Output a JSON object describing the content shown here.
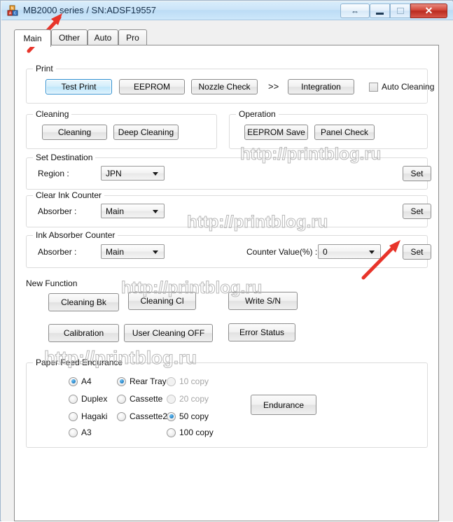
{
  "window": {
    "title": "MB2000 series / SN:ADSF19557",
    "app_icon": "blocks-icon",
    "controls": {
      "resize_label": "⇔",
      "minimize_label": "",
      "maximize_label": "",
      "close_label": "✕"
    }
  },
  "tabs": [
    {
      "label": "Main",
      "active": true
    },
    {
      "label": "Other",
      "active": false
    },
    {
      "label": "Auto",
      "active": false
    },
    {
      "label": "Pro",
      "active": false
    }
  ],
  "print_group": {
    "title": "Print",
    "buttons": [
      {
        "label": "Test Print",
        "focused": true
      },
      {
        "label": "EEPROM",
        "focused": false
      },
      {
        "label": "Nozzle Check",
        "focused": false
      },
      {
        "label": "Integration",
        "focused": false
      }
    ],
    "separator": ">>",
    "checkbox": {
      "label": "Auto Cleaning",
      "checked": false
    }
  },
  "cleaning_group": {
    "title": "Cleaning",
    "buttons": [
      {
        "label": "Cleaning"
      },
      {
        "label": "Deep Cleaning"
      }
    ]
  },
  "operation_group": {
    "title": "Operation",
    "buttons": [
      {
        "label": "EEPROM Save"
      },
      {
        "label": "Panel Check"
      }
    ]
  },
  "set_destination_group": {
    "title": "Set Destination",
    "region_label": "Region :",
    "region_value": "JPN",
    "set_label": "Set"
  },
  "clear_ink_counter_group": {
    "title": "Clear Ink Counter",
    "absorber_label": "Absorber :",
    "absorber_value": "Main",
    "set_label": "Set"
  },
  "ink_absorber_counter_group": {
    "title": "Ink Absorber Counter",
    "absorber_label": "Absorber :",
    "absorber_value": "Main",
    "counter_label": "Counter Value(%) :",
    "counter_value": "0",
    "set_label": "Set"
  },
  "new_function": {
    "title": "New Function",
    "buttons": [
      {
        "label": "Cleaning Bk"
      },
      {
        "label": "Cleaning Cl"
      },
      {
        "label": "Write S/N"
      },
      {
        "label": "Calibration"
      },
      {
        "label": "User Cleaning OFF"
      },
      {
        "label": "Error Status"
      }
    ]
  },
  "paper_feed_endurance": {
    "title": "Paper Feed Endurance",
    "paper_options": [
      {
        "label": "A4",
        "checked": true,
        "disabled": false
      },
      {
        "label": "Duplex",
        "checked": false,
        "disabled": false
      },
      {
        "label": "Hagaki",
        "checked": false,
        "disabled": false
      },
      {
        "label": "A3",
        "checked": false,
        "disabled": false
      }
    ],
    "source_options": [
      {
        "label": "Rear Tray",
        "checked": true,
        "disabled": false
      },
      {
        "label": "Cassette",
        "checked": false,
        "disabled": false
      },
      {
        "label": "Cassette2",
        "checked": false,
        "disabled": false
      }
    ],
    "copy_options": [
      {
        "label": "10 copy",
        "checked": false,
        "disabled": true
      },
      {
        "label": "20 copy",
        "checked": false,
        "disabled": true
      },
      {
        "label": "50 copy",
        "checked": true,
        "disabled": false
      },
      {
        "label": "100 copy",
        "checked": false,
        "disabled": false
      }
    ],
    "endurance_label": "Endurance"
  },
  "watermarks": [
    {
      "text": "http://printblog.ru"
    },
    {
      "text": "http://printblog.ru"
    },
    {
      "text": "http://printblog.ru"
    },
    {
      "text": "http://printblog.ru"
    }
  ],
  "colors": {
    "titlebar": "#cbe4f8",
    "close_button": "#c33323",
    "focus_accent": "#2c8fd0",
    "arrow_red": "#e8342a",
    "panel_bg": "#ffffff",
    "group_border": "#dcdcdc"
  }
}
